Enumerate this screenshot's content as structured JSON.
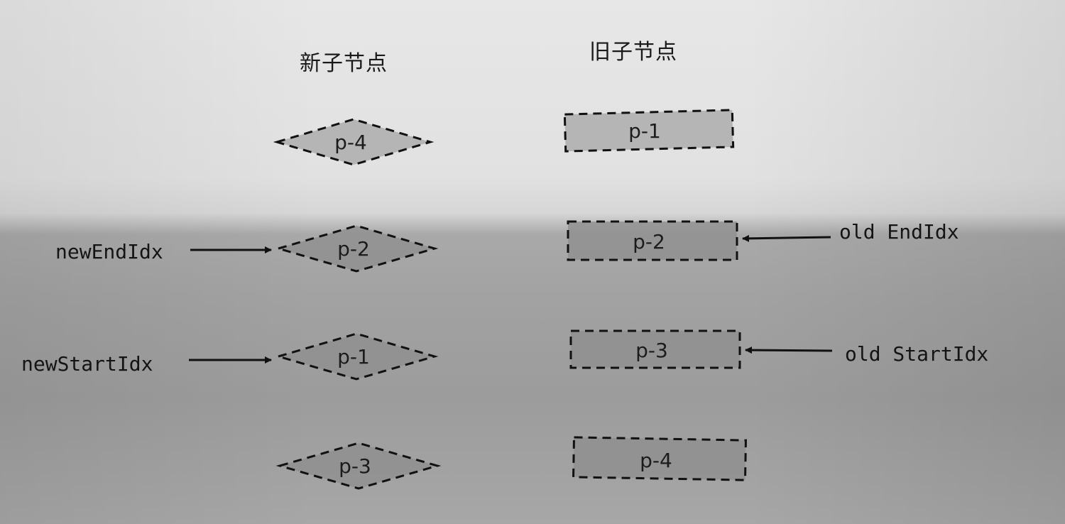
{
  "headings": {
    "new_children": "新子节点",
    "old_children": "旧子节点"
  },
  "new_children": [
    {
      "label": "p-4"
    },
    {
      "label": "p-2"
    },
    {
      "label": "p-1"
    },
    {
      "label": "p-3"
    }
  ],
  "old_children": [
    {
      "label": "p-1"
    },
    {
      "label": "p-2"
    },
    {
      "label": "p-3"
    },
    {
      "label": "p-4"
    }
  ],
  "pointers": {
    "new_end": "newEndIdx",
    "new_start": "newStartIdx",
    "old_end": "old EndIdx",
    "old_start": "old StartIdx"
  },
  "colors": {
    "node_fill": "#a6a6a6",
    "node_stroke": "#111111",
    "arrow": "#111111"
  }
}
